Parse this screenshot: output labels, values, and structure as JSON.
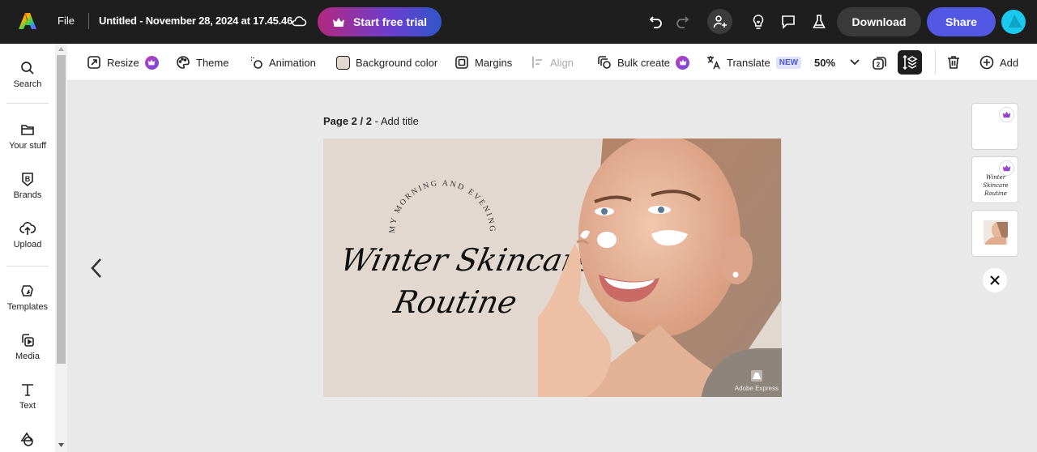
{
  "topbar": {
    "file_label": "File",
    "document_title": "Untitled - November 28, 2024 at 17.45.46",
    "trial_label": "Start free trial",
    "download_label": "Download",
    "share_label": "Share"
  },
  "sidebar": {
    "items": [
      {
        "label": "Search",
        "icon": "search-icon"
      },
      {
        "label": "Your stuff",
        "icon": "folder-icon"
      },
      {
        "label": "Brands",
        "icon": "brand-icon"
      },
      {
        "label": "Upload",
        "icon": "upload-icon"
      },
      {
        "label": "Templates",
        "icon": "templates-icon"
      },
      {
        "label": "Media",
        "icon": "media-icon"
      },
      {
        "label": "Text",
        "icon": "text-icon"
      },
      {
        "label": "",
        "icon": "elements-icon"
      }
    ]
  },
  "toolbar": {
    "resize": "Resize",
    "theme": "Theme",
    "animation": "Animation",
    "background_color": "Background color",
    "background_swatch": "#e2d8cf",
    "margins": "Margins",
    "align": "Align",
    "bulk_create": "Bulk create",
    "translate": "Translate",
    "new_badge": "NEW",
    "zoom": "50%",
    "page_count_badge": "2",
    "add": "Add"
  },
  "page": {
    "page_prefix": "Page 2 / 2",
    "separator": " - ",
    "add_title": "Add title"
  },
  "design": {
    "arc_text": "MY MORNING AND EVENING",
    "title_line1": "Winter Skincare",
    "title_line2": "Routine",
    "watermark": "Adobe Express",
    "background": "#e2d8cf"
  },
  "thumbnails": [
    {
      "name": "page-1",
      "premium": true
    },
    {
      "name": "page-2",
      "premium": true,
      "caption": "Winter Skincare Routine"
    },
    {
      "name": "page-3",
      "premium": false
    }
  ],
  "colors": {
    "accent": "#5258e4",
    "trial_gradient_start": "#b3297f",
    "trial_gradient_end": "#2f56c9",
    "topbar": "#1e1e1e"
  }
}
